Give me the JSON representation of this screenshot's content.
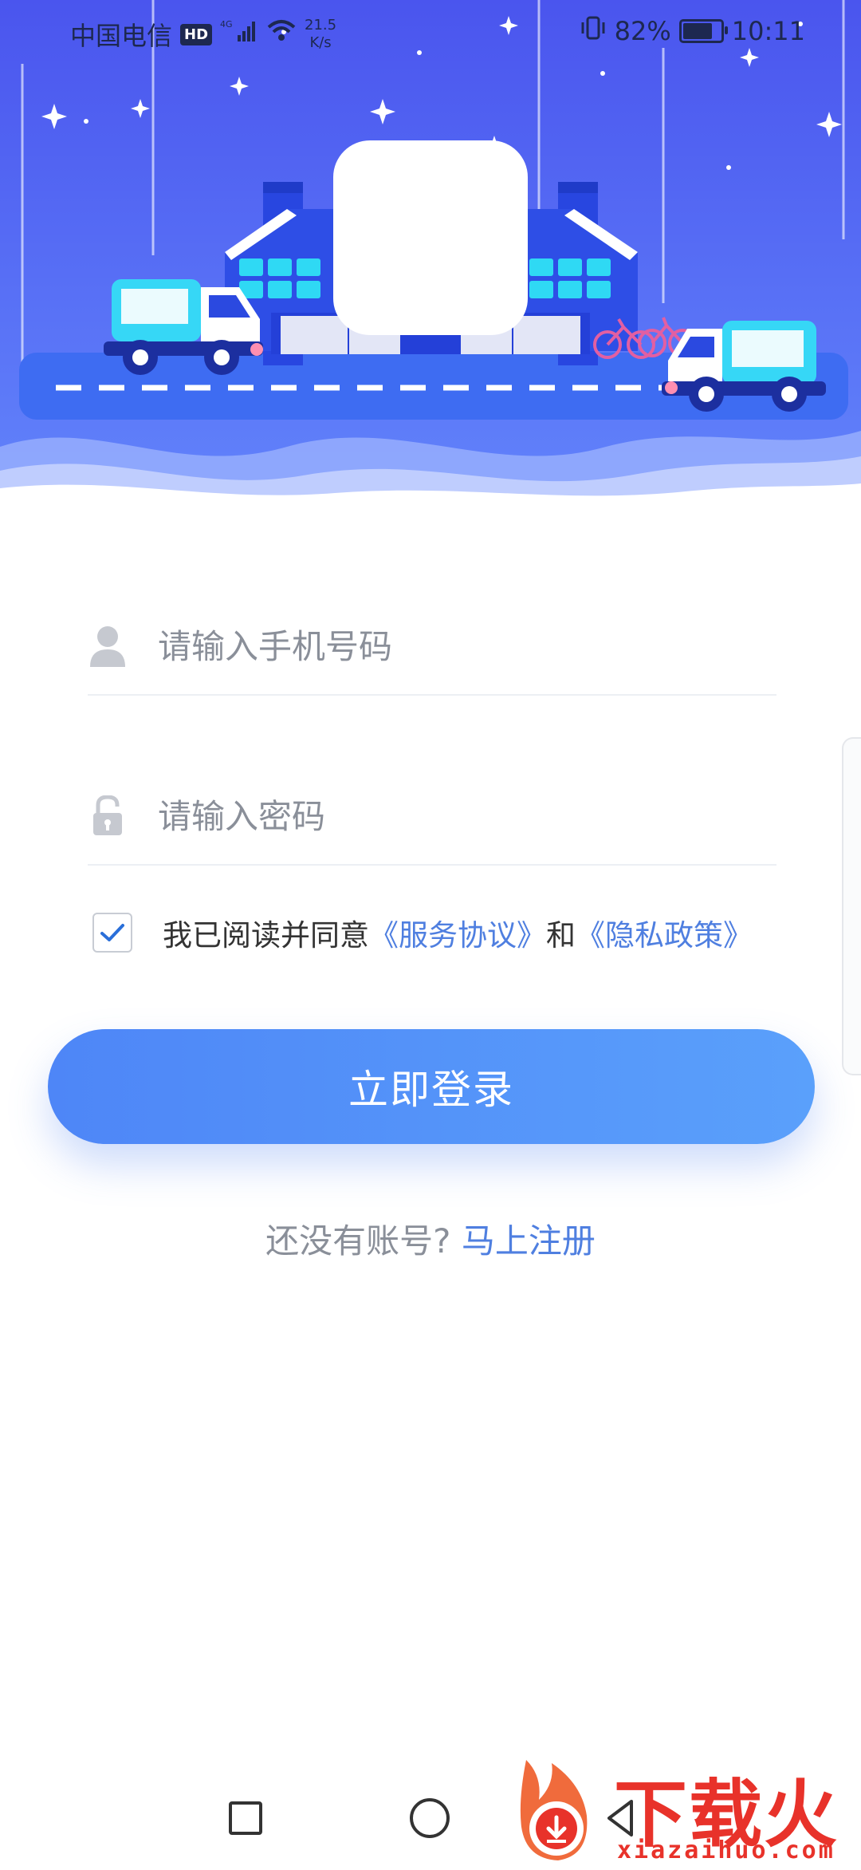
{
  "status_bar": {
    "carrier": "中国电信",
    "hd": "HD",
    "net_type": "4G",
    "speed_value": "21.5",
    "speed_unit": "K/s",
    "battery": "82%",
    "battery_level": 0.82,
    "time": "10:11"
  },
  "login": {
    "phone_placeholder": "请输入手机号码",
    "password_placeholder": "请输入密码",
    "agree_prefix": "我已阅读并同意",
    "service_link": "《服务协议》",
    "agree_and": "和",
    "privacy_link": "《隐私政策》",
    "agree_checked": true,
    "login_button": "立即登录",
    "register_prompt": "还没有账号?",
    "register_link": "马上注册"
  },
  "watermark": {
    "text": "下载火",
    "sub": "xiazaihuo.com"
  },
  "colors": {
    "banner_top": "#4a5cf0",
    "banner_bottom": "#6a86fb",
    "accent": "#4f7fe0",
    "button": "#5590f9",
    "watermark": "#e8322a"
  }
}
